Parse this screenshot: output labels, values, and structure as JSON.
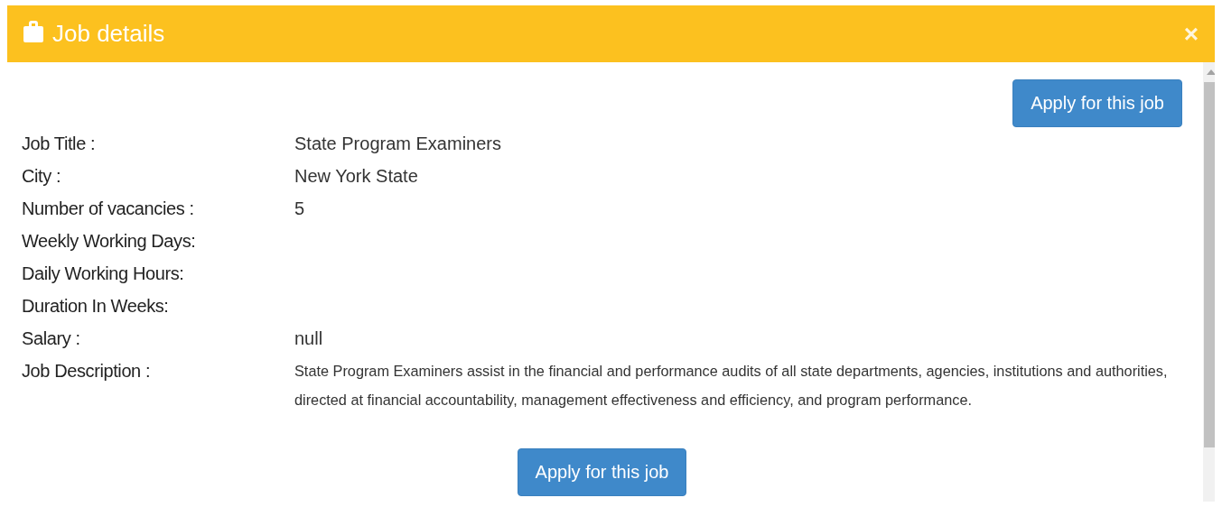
{
  "window": {
    "title": "Job details",
    "close": "×"
  },
  "apply_buttons": [
    "Apply for this job",
    "Apply for this job"
  ],
  "fields": [
    {
      "label": "Job Title :",
      "value": "State Program Examiners"
    },
    {
      "label": "City :",
      "value": "New York State"
    },
    {
      "label": "Number of vacancies :",
      "value": "5"
    },
    {
      "label": "Weekly Working Days:"
    },
    {
      "label": "Daily Working Hours:"
    },
    {
      "label": "Duration In Weeks:"
    },
    {
      "label": "Salary :",
      "value": "null"
    },
    {
      "label": "Job Description :",
      "value": "State Program Examiners assist in the financial and performance audits of all state departments, agencies, institutions and authorities, directed at financial accountability, management effectiveness and efficiency, and program performance.",
      "kind": "paragraph"
    }
  ]
}
